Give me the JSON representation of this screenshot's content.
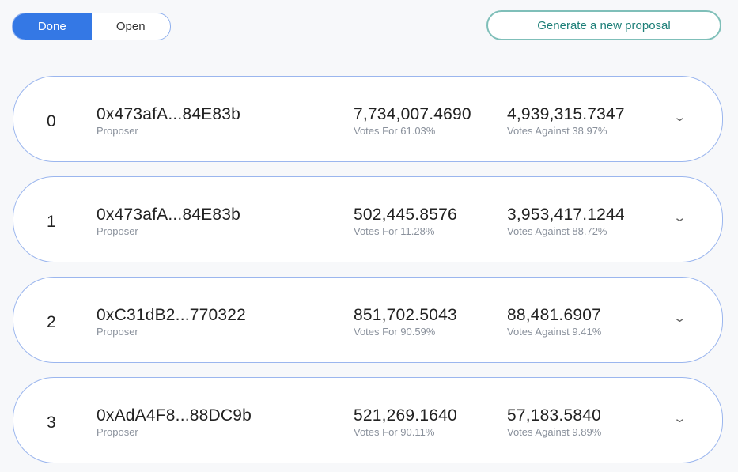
{
  "filter": {
    "done": "Done",
    "open": "Open"
  },
  "generate_label": "Generate a new proposal",
  "proposals": [
    {
      "id": "0",
      "proposer": "0x473afA...84E83b",
      "proposer_label": "Proposer",
      "votes_for": "7,734,007.4690",
      "votes_for_label": "Votes For 61.03%",
      "votes_against": "4,939,315.7347",
      "votes_against_label": "Votes Against 38.97%"
    },
    {
      "id": "1",
      "proposer": "0x473afA...84E83b",
      "proposer_label": "Proposer",
      "votes_for": "502,445.8576",
      "votes_for_label": "Votes For 11.28%",
      "votes_against": "3,953,417.1244",
      "votes_against_label": "Votes Against 88.72%"
    },
    {
      "id": "2",
      "proposer": "0xC31dB2...770322",
      "proposer_label": "Proposer",
      "votes_for": "851,702.5043",
      "votes_for_label": "Votes For 90.59%",
      "votes_against": "88,481.6907",
      "votes_against_label": "Votes Against 9.41%"
    },
    {
      "id": "3",
      "proposer": "0xAdA4F8...88DC9b",
      "proposer_label": "Proposer",
      "votes_for": "521,269.1640",
      "votes_for_label": "Votes For 90.11%",
      "votes_against": "57,183.5840",
      "votes_against_label": "Votes Against 9.89%"
    }
  ],
  "chevron": "⌄"
}
